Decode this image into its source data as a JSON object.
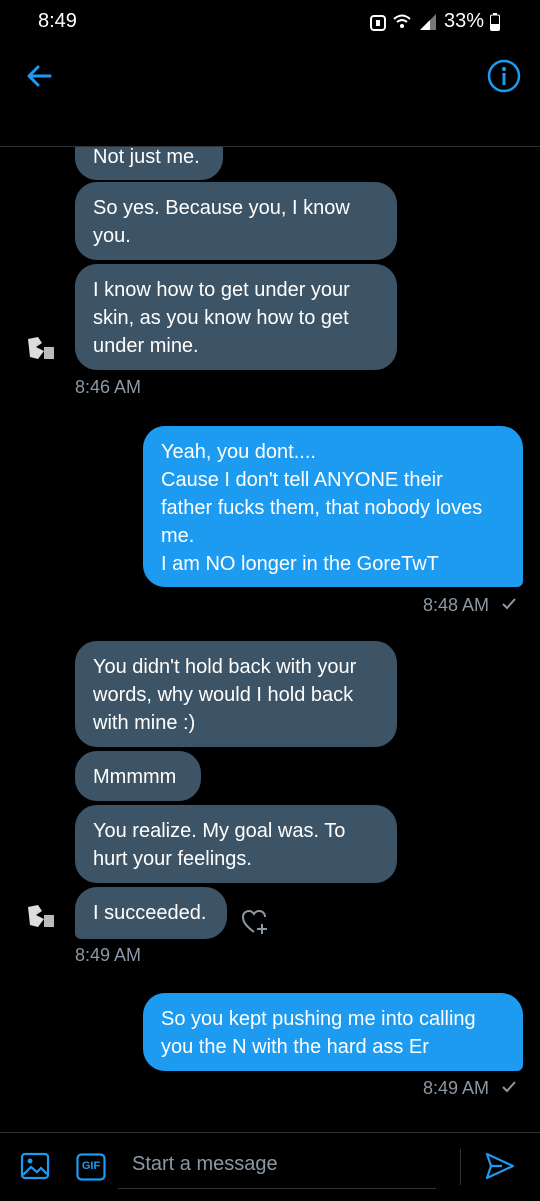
{
  "status": {
    "time": "8:49",
    "battery": "33%"
  },
  "header": {
    "back_icon": "arrow-left-icon",
    "info_icon": "info-icon"
  },
  "messages": [
    {
      "dir": "recv",
      "text": "Not just me."
    },
    {
      "dir": "recv",
      "text": "So yes. Because you, I know\nyou."
    },
    {
      "dir": "recv",
      "text": "I know how to get under your\nskin, as you know how to get\nunder mine."
    },
    {
      "dir": "time",
      "text": "8:46 AM"
    },
    {
      "dir": "sent",
      "text": "Yeah, you dont....\nCause I don't tell ANYONE their\nfather fucks them, that nobody loves\nme.\nI am NO longer in the GoreTwT"
    },
    {
      "dir": "time",
      "text": "8:48 AM"
    },
    {
      "dir": "recv",
      "text": "You didn't hold back with your\nwords, why would I hold back\nwith mine :)"
    },
    {
      "dir": "recv",
      "text": "Mmmmm"
    },
    {
      "dir": "recv",
      "text": "You realize. My goal was. To\nhurt your feelings."
    },
    {
      "dir": "recv",
      "text": "I succeeded."
    },
    {
      "dir": "time",
      "text": "8:49 AM"
    },
    {
      "dir": "sent",
      "text": "So you kept pushing me into calling\nyou the N with the hard ass Er"
    },
    {
      "dir": "time",
      "text": "8:49 AM"
    }
  ],
  "composer": {
    "placeholder": "Start a message",
    "gif_label": "GIF"
  },
  "colors": {
    "accent": "#1d9bf0",
    "received": "#3d5466",
    "muted": "#8b98a5"
  }
}
